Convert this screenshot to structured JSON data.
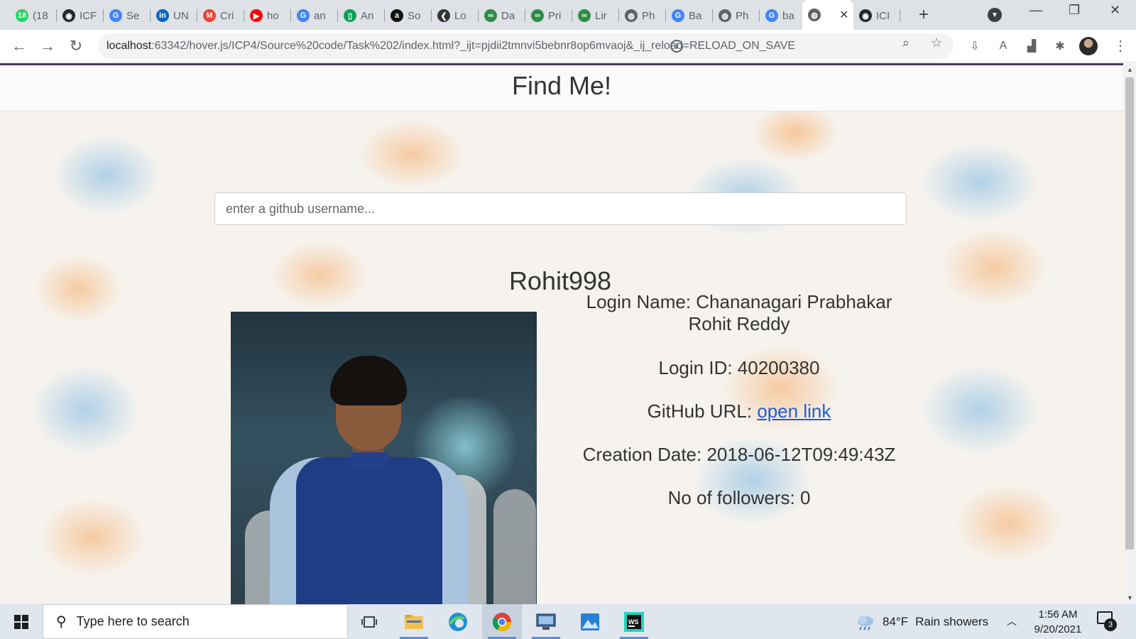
{
  "browser": {
    "tabs": [
      {
        "label": "(18",
        "icon": "whatsapp-icon",
        "icon_color": "#25d366",
        "glyph": "18"
      },
      {
        "label": "ICF",
        "icon": "github-icon",
        "icon_color": "#24292e",
        "glyph": "◉"
      },
      {
        "label": "Se",
        "icon": "google-icon",
        "icon_color": "#4285f4",
        "glyph": "G"
      },
      {
        "label": "UN",
        "icon": "linkedin-icon",
        "icon_color": "#0a66c2",
        "glyph": "in"
      },
      {
        "label": "Cri",
        "icon": "gmail-icon",
        "icon_color": "#ea4335",
        "glyph": "M"
      },
      {
        "label": "ho",
        "icon": "youtube-icon",
        "icon_color": "#ff0000",
        "glyph": "▶"
      },
      {
        "label": "an",
        "icon": "google-icon",
        "icon_color": "#4285f4",
        "glyph": "G"
      },
      {
        "label": "An",
        "icon": "sheets-icon",
        "icon_color": "#0f9d58",
        "glyph": "▯"
      },
      {
        "label": "So",
        "icon": "amazon-icon",
        "icon_color": "#111111",
        "glyph": "a"
      },
      {
        "label": "Lo",
        "icon": "leaf-icon",
        "icon_color": "#333333",
        "glyph": "❮"
      },
      {
        "label": "Da",
        "icon": "gfg-icon",
        "icon_color": "#2f8d46",
        "glyph": "∞"
      },
      {
        "label": "Pri",
        "icon": "gfg-icon",
        "icon_color": "#2f8d46",
        "glyph": "∞"
      },
      {
        "label": "Lir",
        "icon": "gfg-icon",
        "icon_color": "#2f8d46",
        "glyph": "∞"
      },
      {
        "label": "Ph",
        "icon": "globe-icon",
        "icon_color": "#5f6368",
        "glyph": "◍"
      },
      {
        "label": "Ba",
        "icon": "google-icon",
        "icon_color": "#4285f4",
        "glyph": "G"
      },
      {
        "label": "Ph",
        "icon": "globe-icon",
        "icon_color": "#5f6368",
        "glyph": "◍"
      },
      {
        "label": "ba",
        "icon": "google-icon",
        "icon_color": "#4285f4",
        "glyph": "G"
      },
      {
        "label": "",
        "icon": "globe-icon",
        "icon_color": "#5f6368",
        "glyph": "◍",
        "active": true
      },
      {
        "label": "ICI",
        "icon": "github-icon",
        "icon_color": "#24292e",
        "glyph": "◉"
      }
    ],
    "address": {
      "host": "localhost",
      "rest": ":63342/hover.js/ICP4/Source%20code/Task%202/index.html?_ijt=pjdii2tmnvi5bebnr8op6mvaoj&_ij_reload=RELOAD_ON_SAVE"
    }
  },
  "page": {
    "header_title": "Find Me!",
    "search_placeholder": "enter a github username...",
    "username": "Rohit998",
    "photo_alt": "Profile photo of Rohit998",
    "login_name_label": "Login Name: ",
    "login_name_value": "Chananagari Prabhakar Rohit Reddy",
    "login_id_label": "Login ID: ",
    "login_id_value": "40200380",
    "github_url_label": "GitHub URL: ",
    "github_url_link": "open link",
    "creation_date_label": "Creation Date: ",
    "creation_date_value": "2018-06-12T09:49:43Z",
    "followers_label": "No of followers: ",
    "followers_value": "0"
  },
  "taskbar": {
    "search_placeholder": "Type here to search",
    "weather_temp": "84°F",
    "weather_desc": "Rain showers",
    "time": "1:56 AM",
    "date": "9/20/2021",
    "notification_count": "3"
  },
  "colors": {
    "link": "#1a5fd6",
    "header_border": "#4a3a63"
  }
}
